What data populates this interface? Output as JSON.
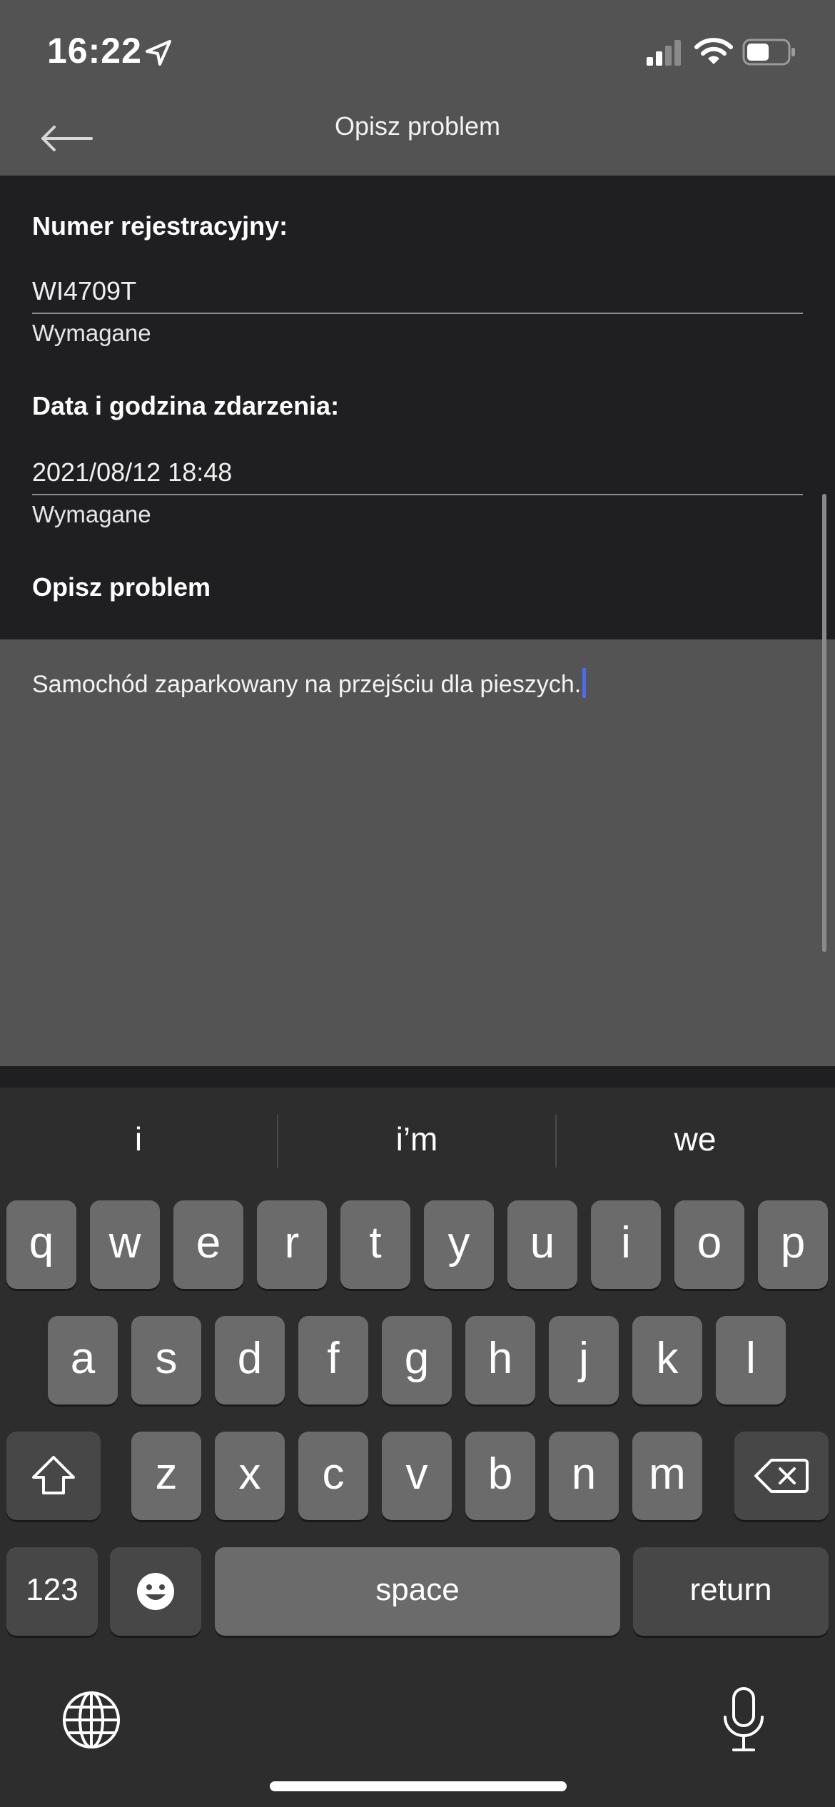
{
  "status_bar": {
    "time": "16:22"
  },
  "header": {
    "title": "Opisz problem"
  },
  "form": {
    "registration": {
      "label": "Numer rejestracyjny:",
      "value": "WI4709T",
      "hint": "Wymagane"
    },
    "datetime": {
      "label": "Data i godzina zdarzenia:",
      "value": "2021/08/12 18:48",
      "hint": "Wymagane"
    },
    "description": {
      "label": "Opisz problem",
      "value": "Samochód zaparkowany na przejściu dla pieszych."
    }
  },
  "keyboard": {
    "suggestions": [
      "i",
      "i’m",
      "we"
    ],
    "row1": [
      "q",
      "w",
      "e",
      "r",
      "t",
      "y",
      "u",
      "i",
      "o",
      "p"
    ],
    "row2": [
      "a",
      "s",
      "d",
      "f",
      "g",
      "h",
      "j",
      "k",
      "l"
    ],
    "row3": [
      "z",
      "x",
      "c",
      "v",
      "b",
      "n",
      "m"
    ],
    "numbers_label": "123",
    "space_label": "space",
    "return_label": "return"
  },
  "colors": {
    "caret": "#4b6cf0",
    "header_bg": "#535353",
    "form_bg": "#1f1f21"
  }
}
